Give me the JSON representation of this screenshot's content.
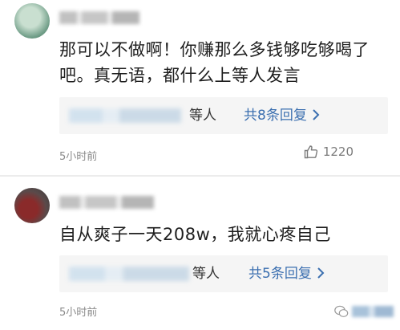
{
  "comments": [
    {
      "body": "那可以不做啊！你赚那么多钱够吃够喝了吧。真无语，都什么上等人发言",
      "reply_suffix": "等人",
      "reply_link": "共8条回复",
      "time": "5小时前",
      "likes": "1220"
    },
    {
      "body": "自从爽子一天208w，我就心疼自己",
      "reply_suffix": "等人",
      "reply_link": "共5条回复",
      "time": "5小时前"
    }
  ],
  "icons": {
    "like": "thumbs-up-icon",
    "chevron": "chevron-right-icon",
    "watermark": "wechat-logo-icon"
  },
  "colors": {
    "link": "#3b6fb0",
    "meta": "#8a8a8a",
    "reply_bg": "#f5f5f5"
  }
}
